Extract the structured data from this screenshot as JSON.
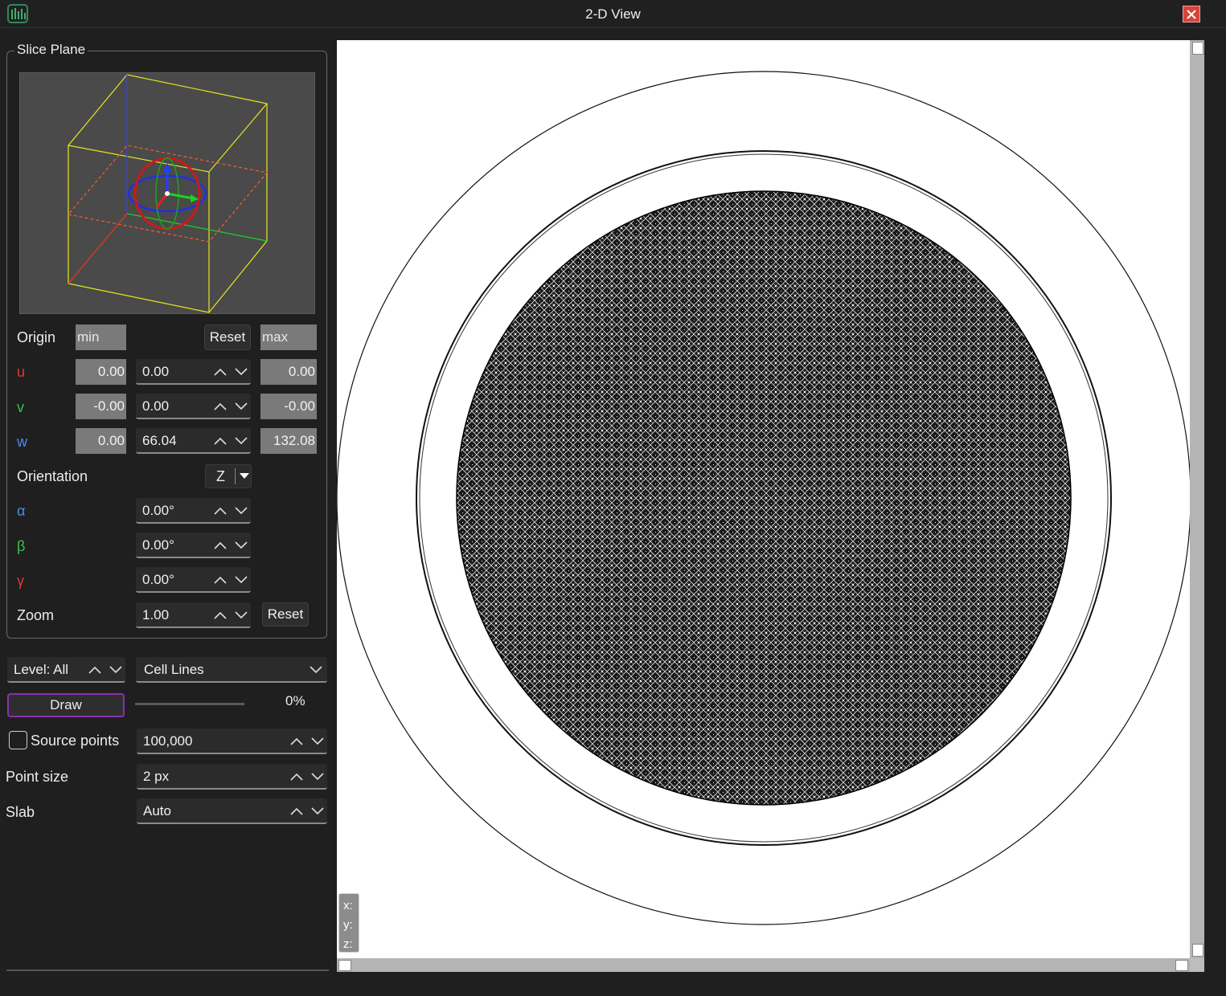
{
  "window": {
    "title": "2-D View"
  },
  "slice_plane": {
    "title": "Slice Plane",
    "origin_label": "Origin",
    "min_placeholder": "min",
    "max_placeholder": "max",
    "reset_label": "Reset",
    "u": {
      "label": "u",
      "min": "0.00",
      "value": "0.00",
      "max": "0.00"
    },
    "v": {
      "label": "v",
      "min": "-0.00",
      "value": "0.00",
      "max": "-0.00"
    },
    "w": {
      "label": "w",
      "min": "0.00",
      "value": "66.04",
      "max": "132.08"
    },
    "orientation_label": "Orientation",
    "orientation_value": "Z",
    "alpha": {
      "label": "α",
      "value": "0.00°"
    },
    "beta": {
      "label": "β",
      "value": "0.00°"
    },
    "gamma": {
      "label": "γ",
      "value": "0.00°"
    },
    "zoom": {
      "label": "Zoom",
      "value": "1.00",
      "reset_label": "Reset"
    }
  },
  "controls": {
    "level": "Level: All",
    "mode": "Cell Lines",
    "draw_label": "Draw",
    "progress": "0%",
    "progress_fraction": 0,
    "source_points_label": "Source points",
    "source_points_checked": false,
    "source_points_value": "100,000",
    "point_size_label": "Point size",
    "point_size_value": "2 px",
    "slab_label": "Slab",
    "slab_value": "Auto"
  },
  "viewport": {
    "coords": {
      "x": "x:",
      "y": "y:",
      "z": "z:"
    }
  },
  "colors": {
    "u_axis": "#e0383a",
    "v_axis": "#3fc050",
    "w_axis": "#4c8cf0",
    "draw_border": "#8a2fb0",
    "close": "#d9433a"
  }
}
